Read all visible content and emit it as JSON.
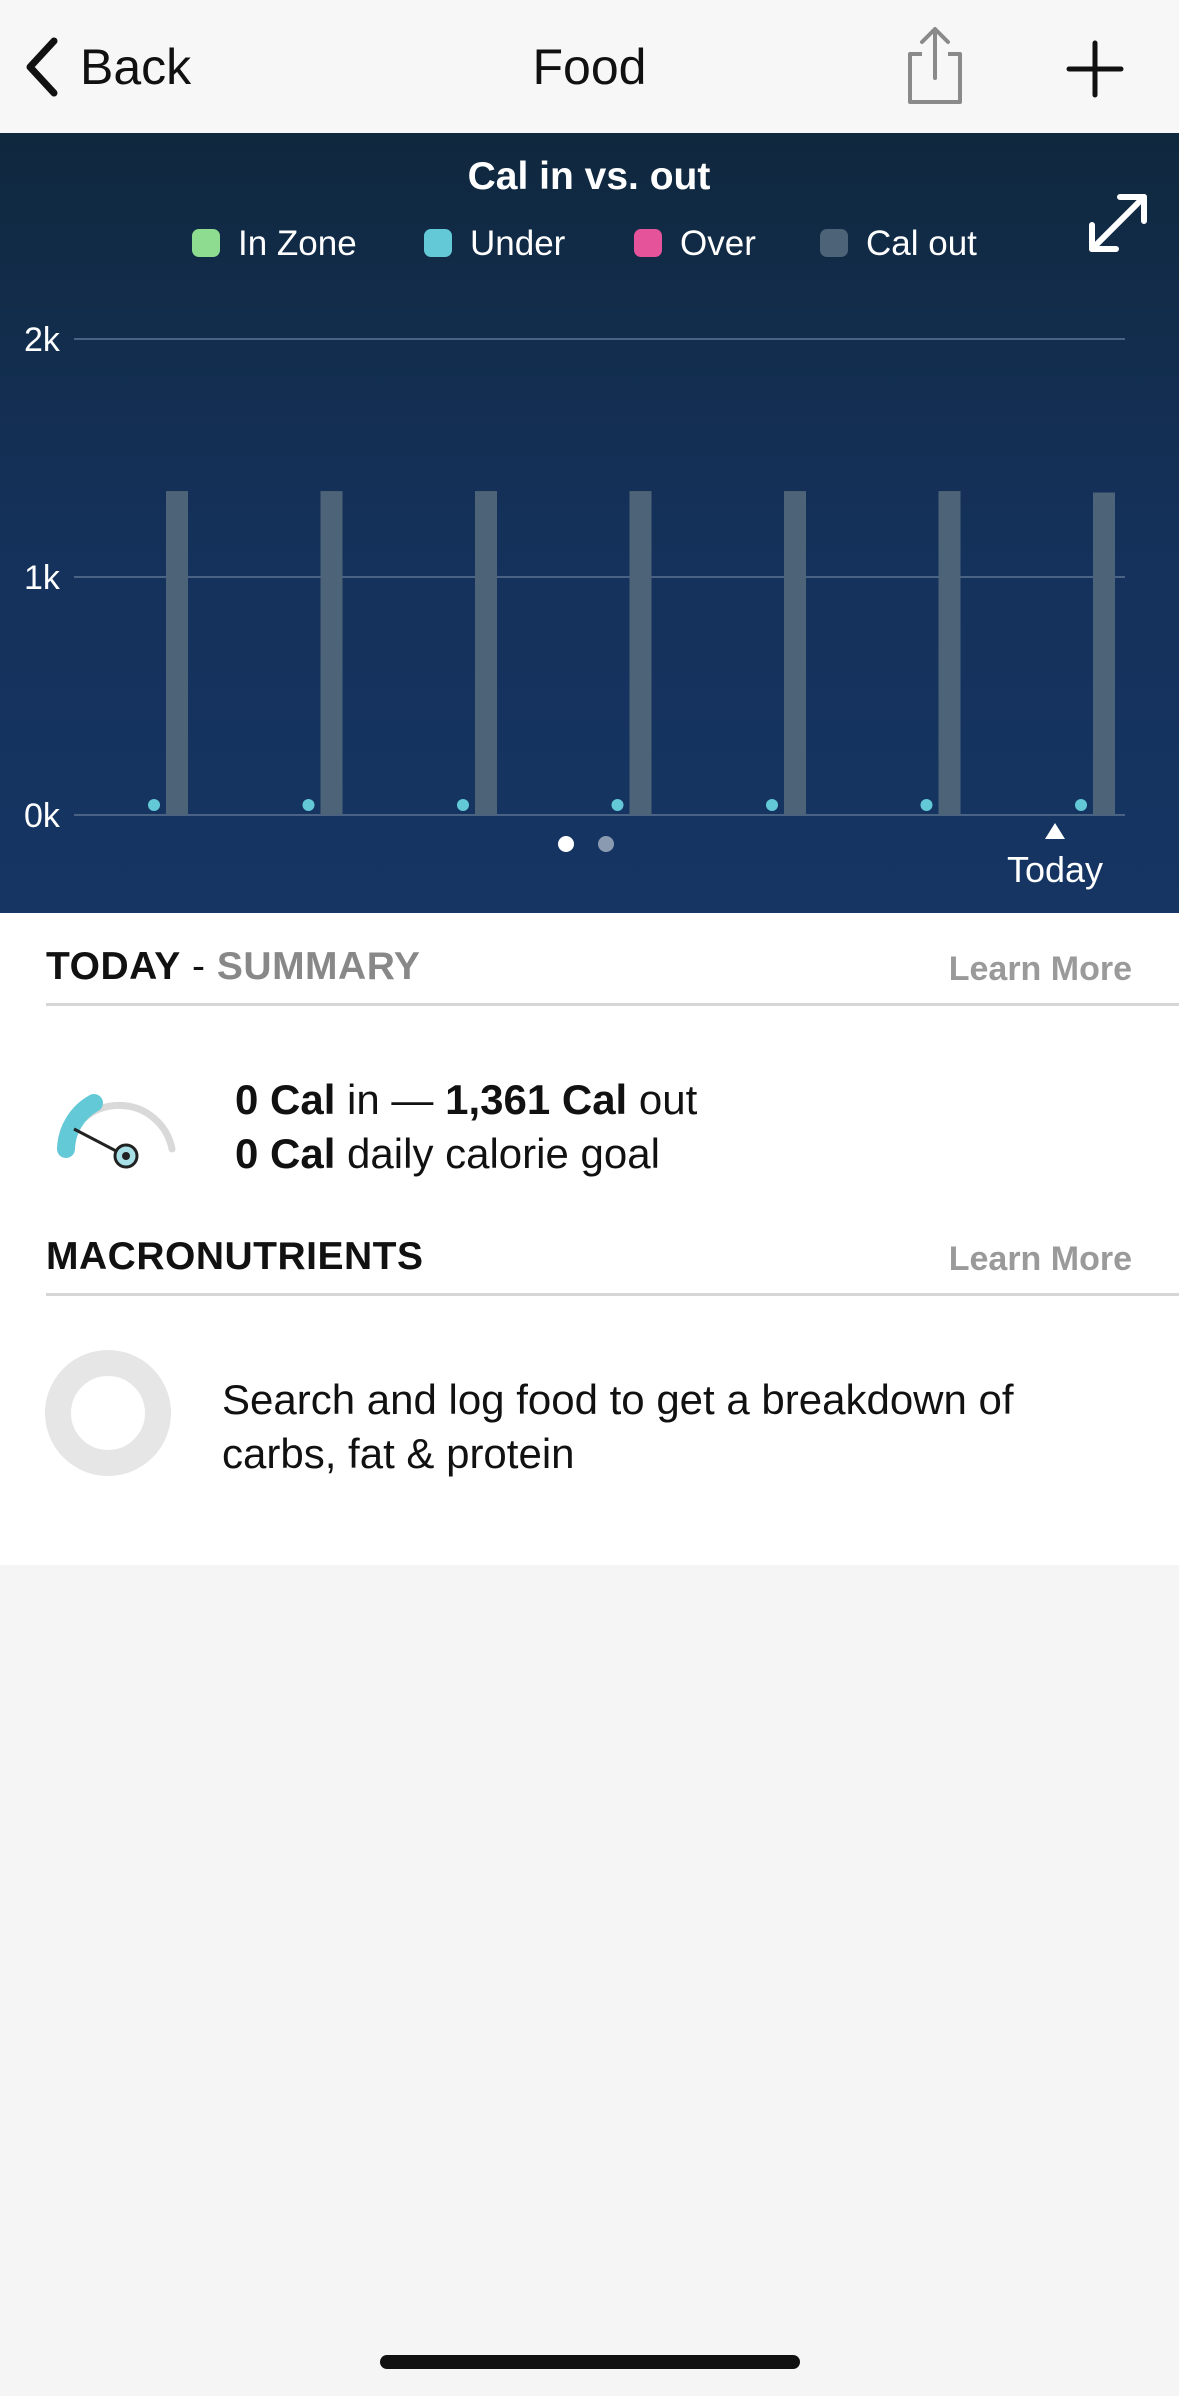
{
  "nav": {
    "back_label": "Back",
    "title": "Food",
    "icons": {
      "back": "chevron-left-icon",
      "share": "share-icon",
      "add": "plus-icon"
    }
  },
  "chart_data": {
    "type": "bar",
    "title": "Cal in vs. out",
    "legend": [
      {
        "name": "In Zone",
        "color": "#8ddc8f"
      },
      {
        "name": "Under",
        "color": "#63c9d6"
      },
      {
        "name": "Over",
        "color": "#e5549a"
      },
      {
        "name": "Cal out",
        "color": "#4d6377"
      }
    ],
    "legend_position": "top",
    "y_ticks": [
      "2k",
      "1k",
      "0k"
    ],
    "ylim": [
      0,
      2000
    ],
    "grid": true,
    "days": 7,
    "series": [
      {
        "name": "Cal out",
        "type": "bar",
        "values": [
          1361,
          1361,
          1361,
          1361,
          1361,
          1361,
          1355
        ]
      },
      {
        "name": "Under",
        "type": "point",
        "values": [
          0,
          0,
          0,
          0,
          0,
          0,
          0
        ]
      }
    ],
    "x_marker_label": "Today",
    "colors": {
      "bar": "#4d6377",
      "point": "#63c9d6",
      "grid": "#4a6283"
    }
  },
  "pager": {
    "pages": 2,
    "active": 0
  },
  "summary": {
    "header_title": "TODAY",
    "header_sep": " - ",
    "header_sub": "SUMMARY",
    "learn_more": "Learn More",
    "cal_in": "0 Cal",
    "in_word": " in — ",
    "cal_out": "1,361 Cal",
    "out_word": " out",
    "goal_value": "0 Cal",
    "goal_text": " daily calorie goal",
    "gauge_icon": "calorie-gauge-icon",
    "gauge_color": "#63c9d6"
  },
  "macros": {
    "header_title": "MACRONUTRIENTS",
    "learn_more": "Learn More",
    "message": "Search and log food to get a breakdown of carbs, fat & protein",
    "donut_icon": "macro-donut-icon"
  }
}
